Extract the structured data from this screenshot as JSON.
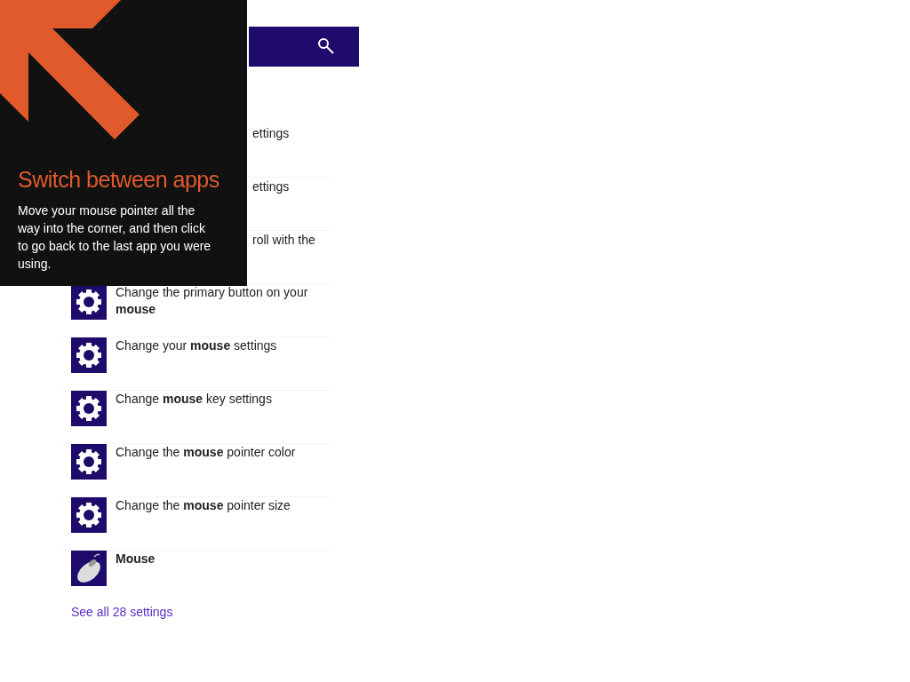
{
  "results": [
    {
      "kind": "covered",
      "text": "ettings"
    },
    {
      "kind": "covered",
      "text": "ettings"
    },
    {
      "kind": "covered",
      "text": "roll with the"
    },
    {
      "kind": "setting",
      "text": "Change the primary button on your **mouse**"
    },
    {
      "kind": "setting",
      "text": "Change your **mouse** settings"
    },
    {
      "kind": "setting",
      "text": "Change **mouse** key settings"
    },
    {
      "kind": "setting",
      "text": "Change the **mouse** pointer color"
    },
    {
      "kind": "setting",
      "text": "Change the **mouse** pointer size"
    },
    {
      "kind": "mouse",
      "text": "Mouse"
    }
  ],
  "see_all_link": "See all 28 settings",
  "tip": {
    "title": "Switch between apps",
    "body": "Move your mouse pointer all the way into the corner, and then click to go back to the last app you were using."
  }
}
